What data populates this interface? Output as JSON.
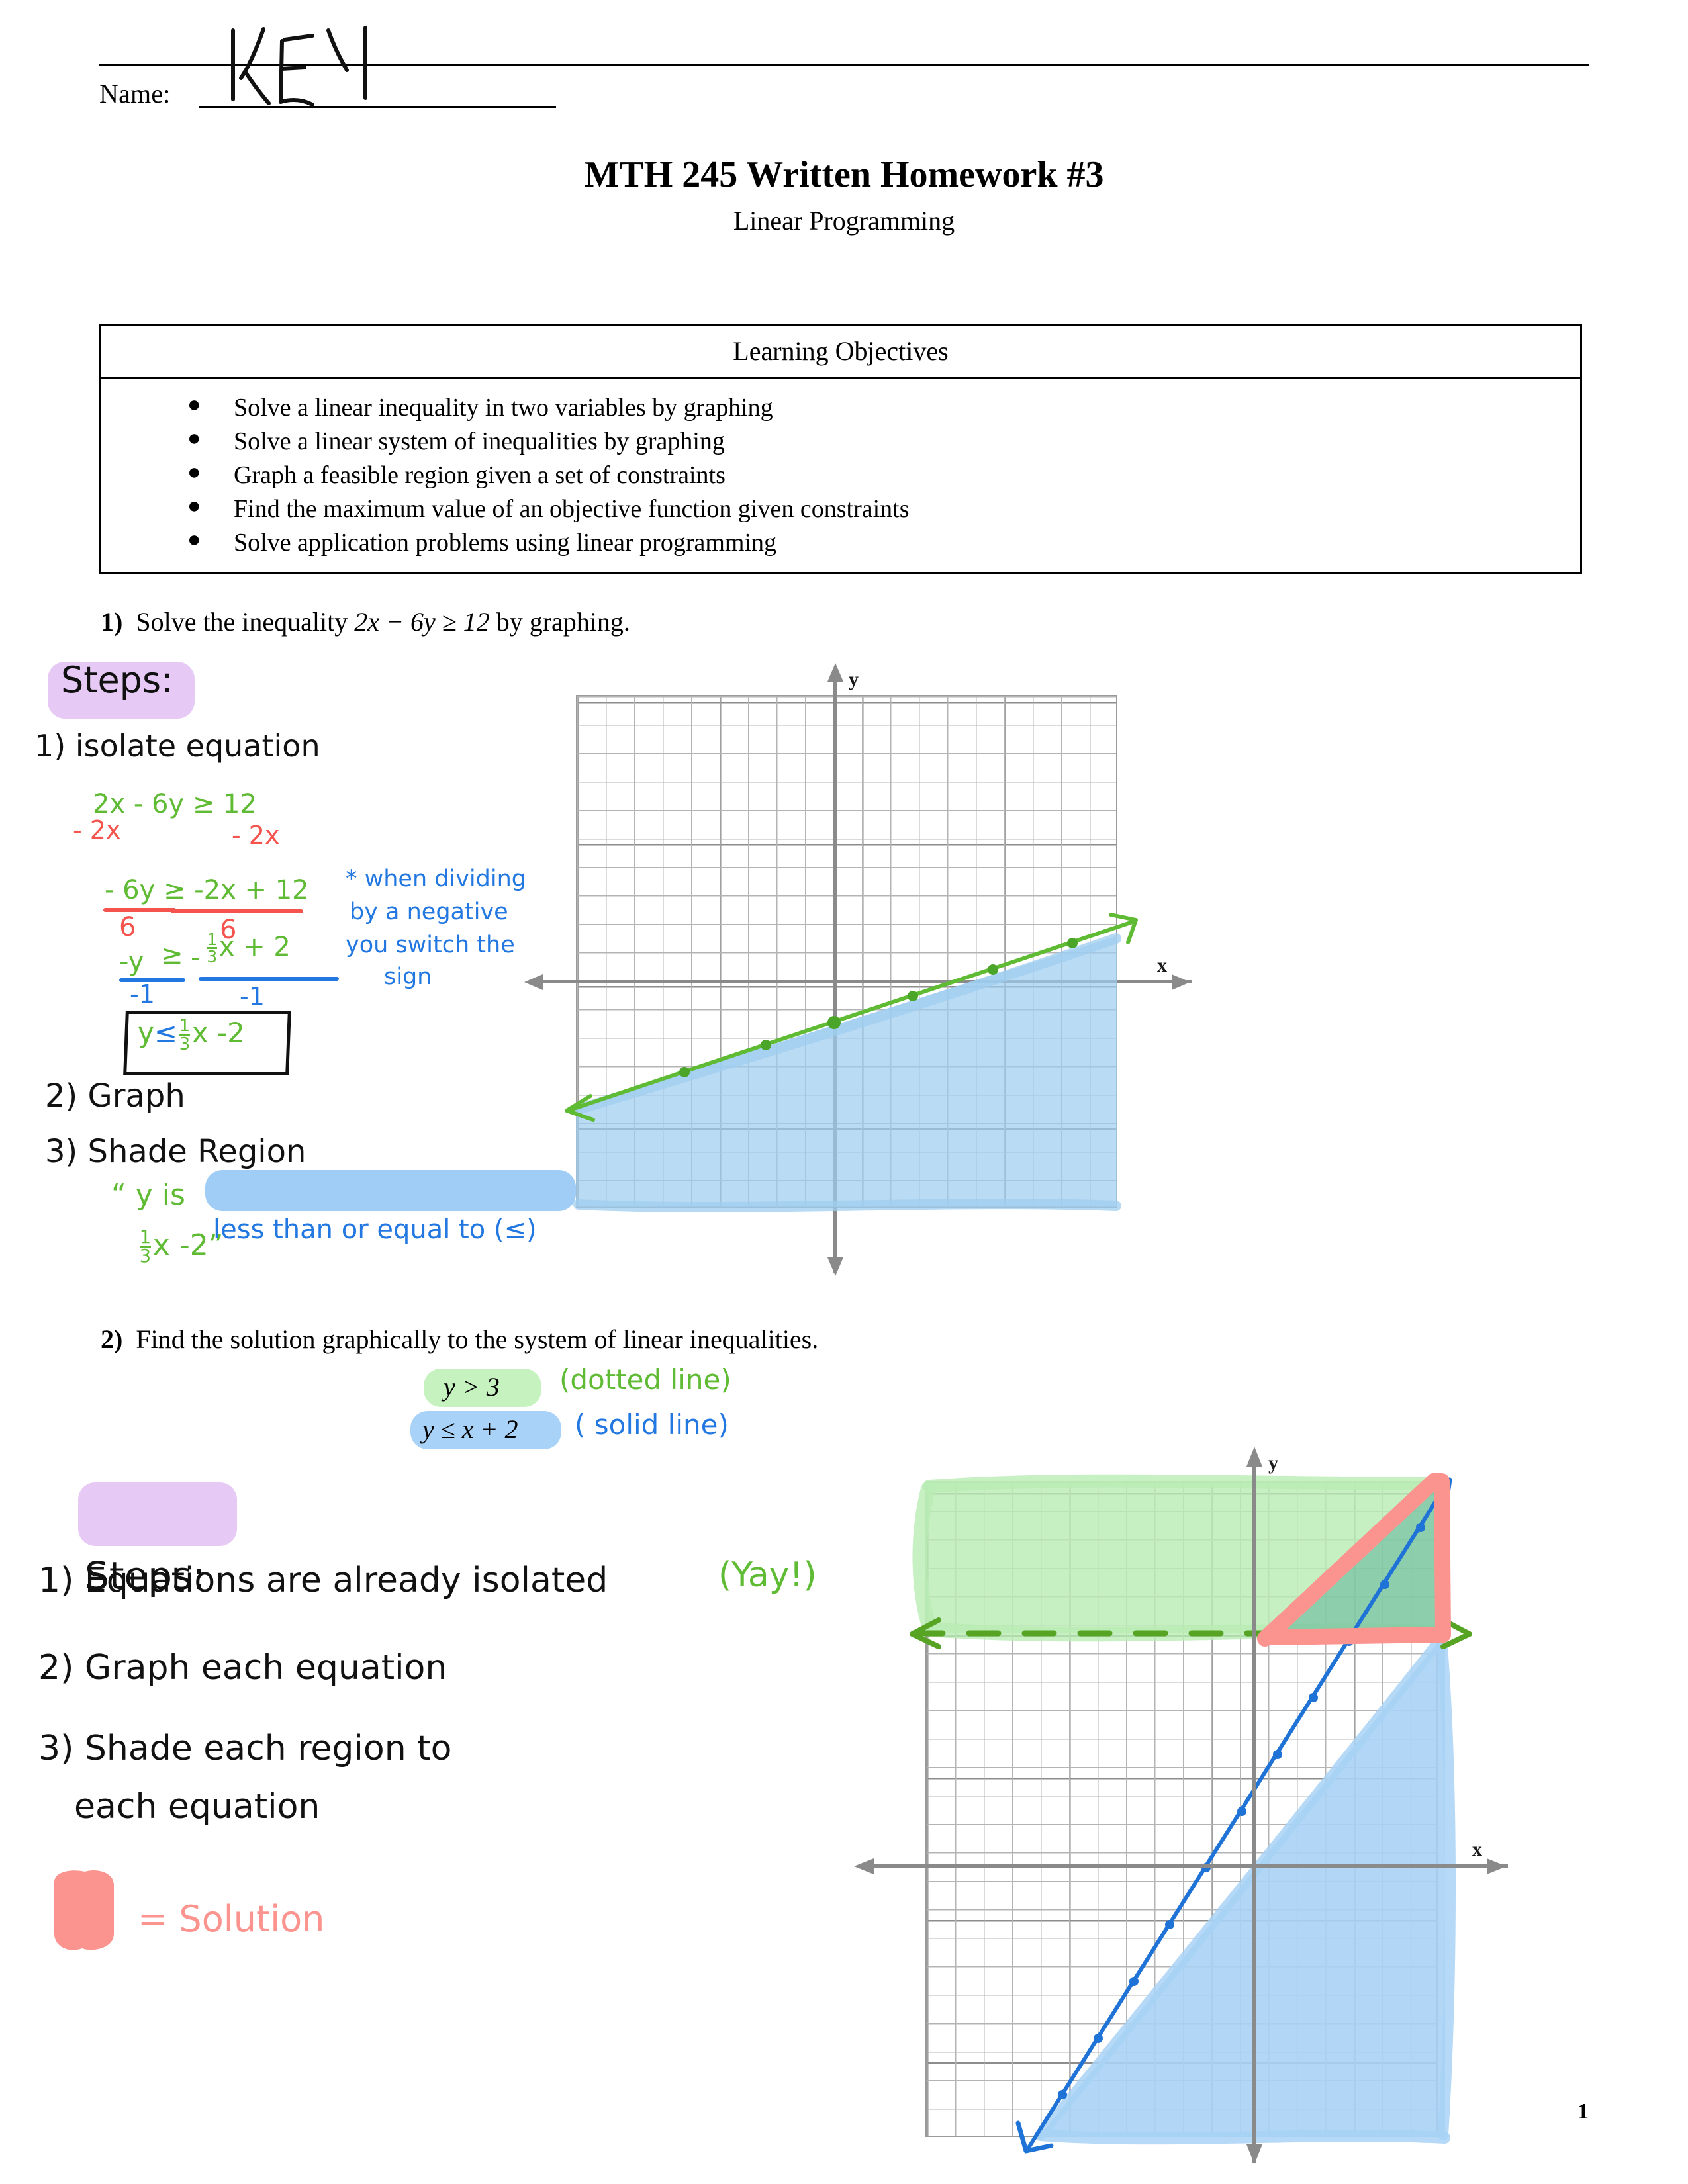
{
  "header": {
    "name_label": "Name:",
    "name_value": "KEY",
    "title": "MTH 245 Written Homework #3",
    "subtitle": "Linear Programming"
  },
  "objectives": {
    "heading": "Learning Objectives",
    "items": [
      "Solve a linear inequality in two variables by graphing",
      "Solve a linear system of inequalities by graphing",
      "Graph a feasible region given a set of constraints",
      "Find the maximum value of an objective function given constraints",
      "Solve application problems using linear programming"
    ]
  },
  "problem1": {
    "number": "1)",
    "text_before": "Solve the inequality",
    "expr": "2x − 6y ≥ 12",
    "text_after": "by graphing.",
    "steps_heading": "Steps:",
    "step1": "1) isolate equation",
    "step2": "2) Graph",
    "step3": "3) Shade Region",
    "work": {
      "line1_green": "2x - 6y ≥ 12",
      "line1_red_left": "- 2x",
      "line1_red_right": "- 2x",
      "line2_green": "- 6y ≥ -2x + 12",
      "line2_den_left": "6",
      "line2_den_right": "6",
      "line3_green_left": "-y",
      "line3_rel": "≥",
      "line3_green_right_num": "1",
      "line3_green_right_den": "3",
      "line3_green_right_rest": "x + 2",
      "line3_green_right_sign": "-",
      "line3_den_left": "-1",
      "line3_den_right": "-1",
      "answer_y": "y",
      "answer_rel": "≤",
      "answer_num": "1",
      "answer_den": "3",
      "answer_rest": "x -2"
    },
    "note_blue": [
      "* when dividing",
      "by a negative",
      "you switch the",
      "sign"
    ],
    "shade_note": {
      "quote_open": "“ y is",
      "highlight": "less than or  equal to (≤)",
      "tail_num": "1",
      "tail_den": "3",
      "tail_rest": "x -2”"
    },
    "graph": {
      "x_axis_label": "x",
      "y_axis_label": "y",
      "boundary": "y = 1/3 x - 2",
      "boundary_style": "solid",
      "shaded_side": "below",
      "shade_color": "#9fcdf0",
      "line_color": "#5fbb33"
    }
  },
  "problem2": {
    "number": "2)",
    "text": "Find the solution graphically to the system of linear inequalities.",
    "ineq1": "y > 3",
    "ineq1_note": "(dotted  line)",
    "ineq2": "y ≤ x + 2",
    "ineq2_note": "( solid  line)",
    "steps_heading": "Steps:",
    "step1": "1) Equations are already  isolated",
    "step1_tail": "(Yay!)",
    "step2": "2) Graph each equation",
    "step3_line1": "3) Shade each region to",
    "step3_line2": "each equation",
    "legend_text": "= Solution",
    "legend_color": "#fb938f",
    "graph": {
      "x_axis_label": "x",
      "y_axis_label": "y",
      "line1": "y = 3",
      "line1_style": "dashed",
      "line1_color": "#5fbb33",
      "line1_shade": "above",
      "line1_shade_color": "#b9ecb4",
      "line2": "y = x + 2",
      "line2_style": "solid",
      "line2_color": "#1f72d6",
      "line2_shade": "below",
      "line2_shade_color": "#a8d2f5",
      "solution_outline_color": "#fb938f",
      "solution_fill_color": "#7dc8b4"
    }
  },
  "footer": {
    "page_number": "1"
  }
}
